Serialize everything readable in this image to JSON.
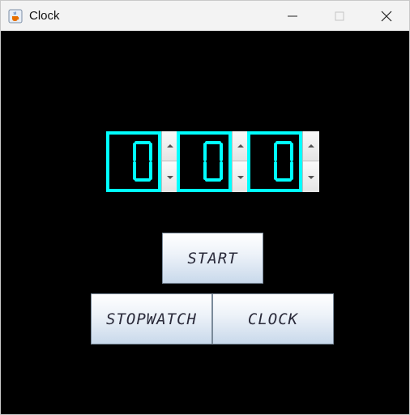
{
  "window": {
    "title": "Clock",
    "icon": "java-cup-icon"
  },
  "controls": {
    "minimize": "minimize-icon",
    "maximize": "maximize-icon",
    "close": "close-icon"
  },
  "spinners": [
    {
      "value": "0"
    },
    {
      "value": "0"
    },
    {
      "value": "0"
    }
  ],
  "buttons": {
    "start_label": "START",
    "stopwatch_label": "STOPWATCH",
    "clock_label": "CLOCK"
  },
  "colors": {
    "digit": "#00ffff",
    "background": "#000000"
  }
}
